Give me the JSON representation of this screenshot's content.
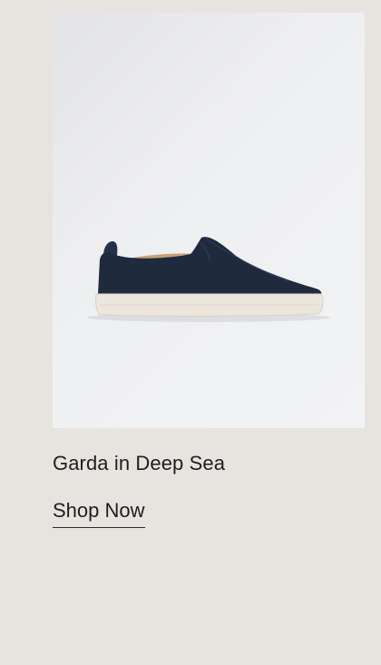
{
  "product": {
    "name": "Garda in Deep Sea",
    "cta_label": "Shop Now",
    "image_subject": "slip-on-sneaker",
    "colors": {
      "upper": "#1f2a3d",
      "sole": "#ece6dc",
      "lining": "#c99f78"
    }
  },
  "page": {
    "background": "#e7e4e0"
  }
}
